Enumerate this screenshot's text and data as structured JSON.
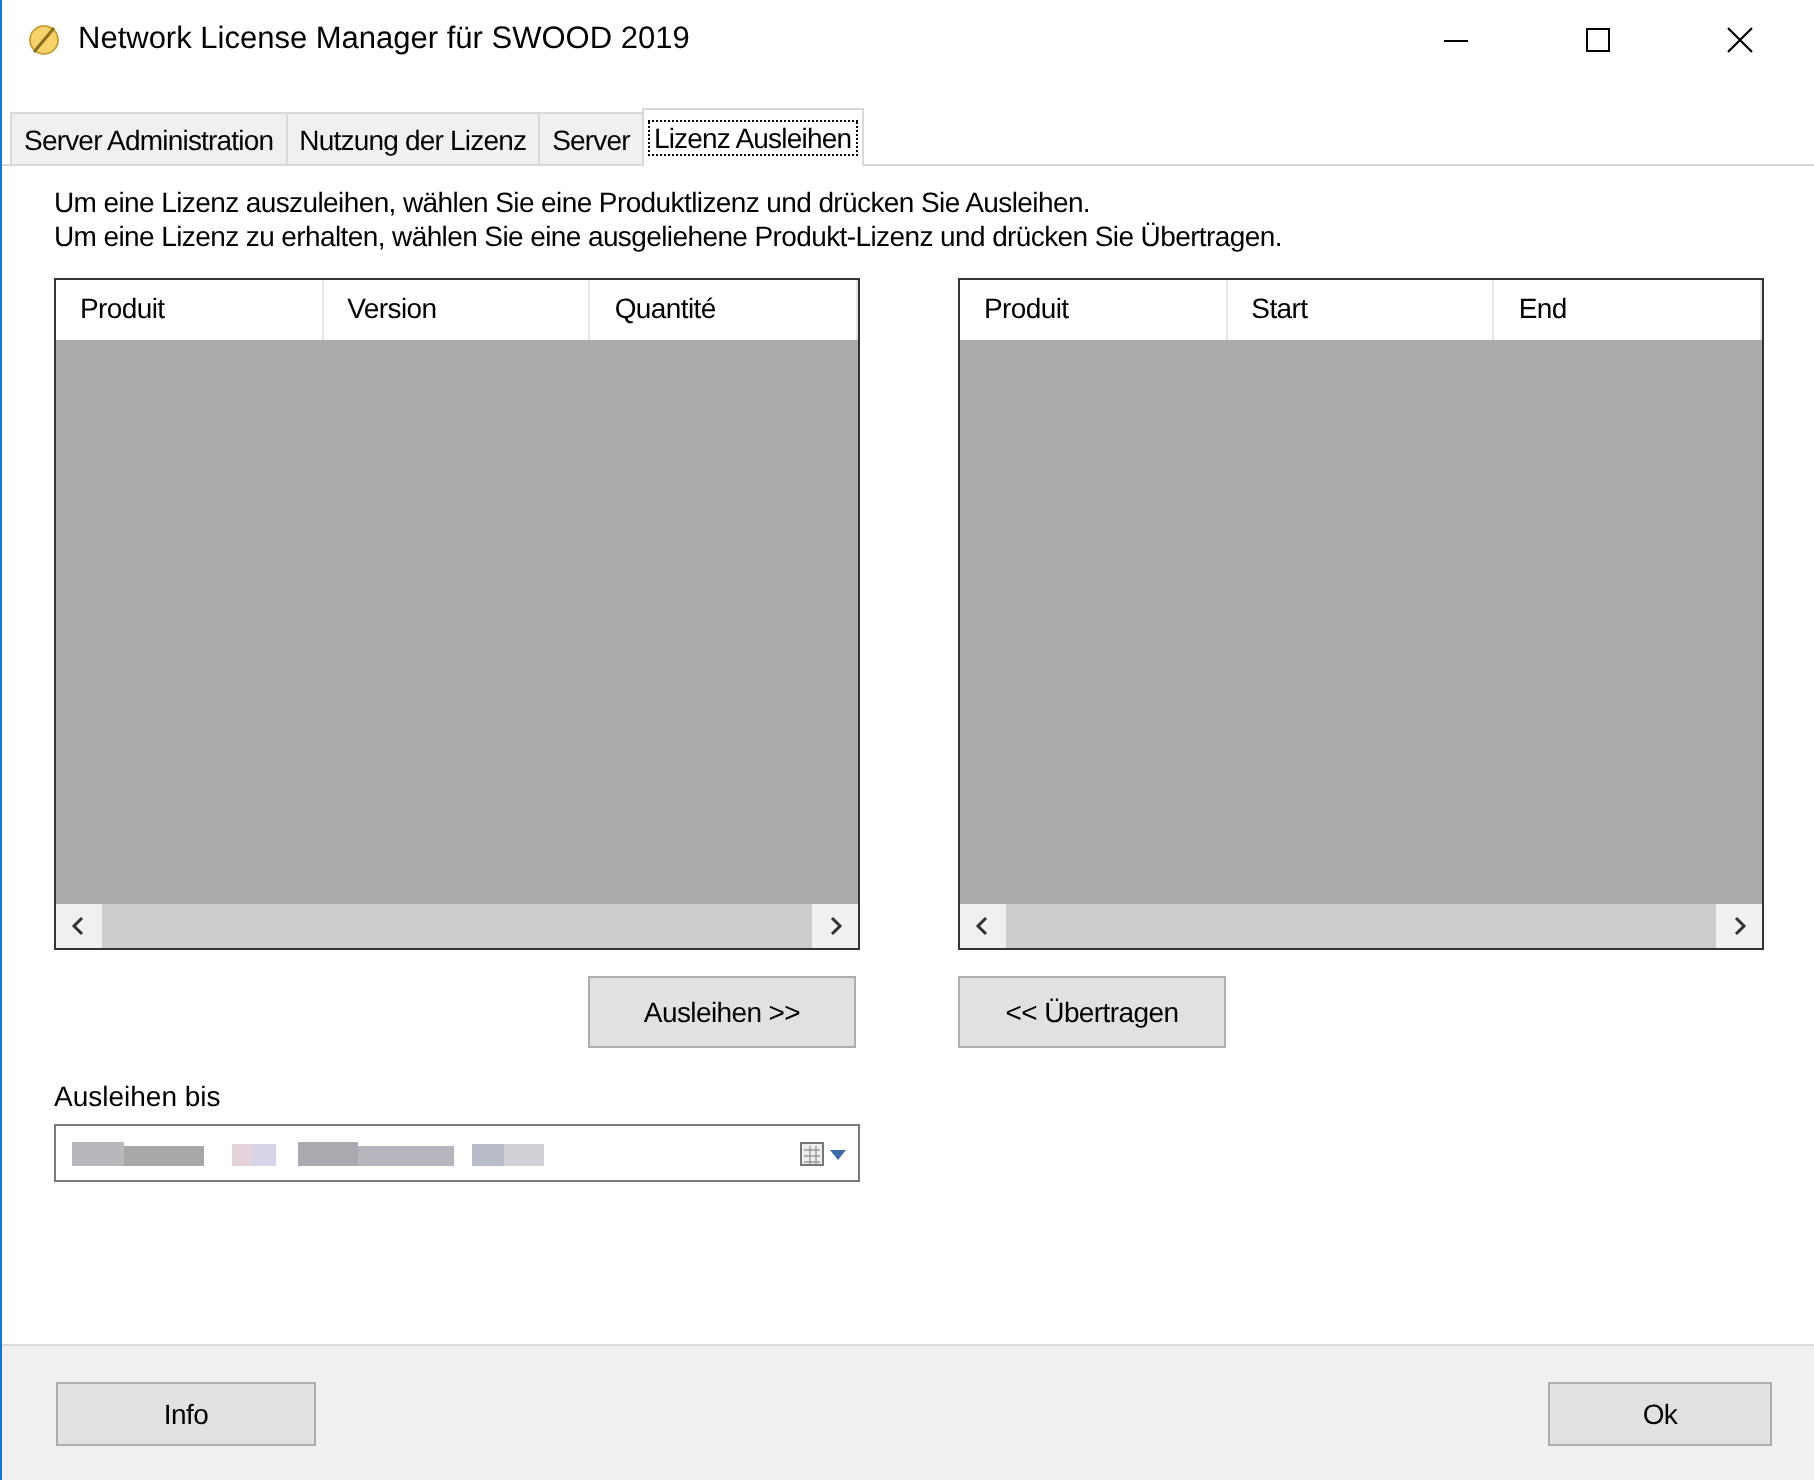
{
  "window": {
    "title": "Network License Manager für SWOOD 2019"
  },
  "tabs": [
    {
      "label": "Server Administration",
      "selected": false
    },
    {
      "label": "Nutzung der Lizenz",
      "selected": false
    },
    {
      "label": "Server",
      "selected": false
    },
    {
      "label": "Lizenz Ausleihen",
      "selected": true
    }
  ],
  "instructions": [
    "Um eine Lizenz auszuleihen, wählen Sie eine Produktlizenz und drücken Sie Ausleihen.",
    "Um eine Lizenz zu erhalten, wählen Sie eine ausgeliehene Produkt-Lizenz und drücken Sie Übertragen."
  ],
  "available_list": {
    "columns": [
      "Produit",
      "Version",
      "Quantité"
    ]
  },
  "borrowed_list": {
    "columns": [
      "Produit",
      "Start",
      "End"
    ]
  },
  "borrow_button": "Ausleihen >>",
  "return_button": "<< Übertragen",
  "borrow_until": {
    "label": "Ausleihen bis"
  },
  "footer_buttons": [
    "Info",
    "Ok"
  ]
}
